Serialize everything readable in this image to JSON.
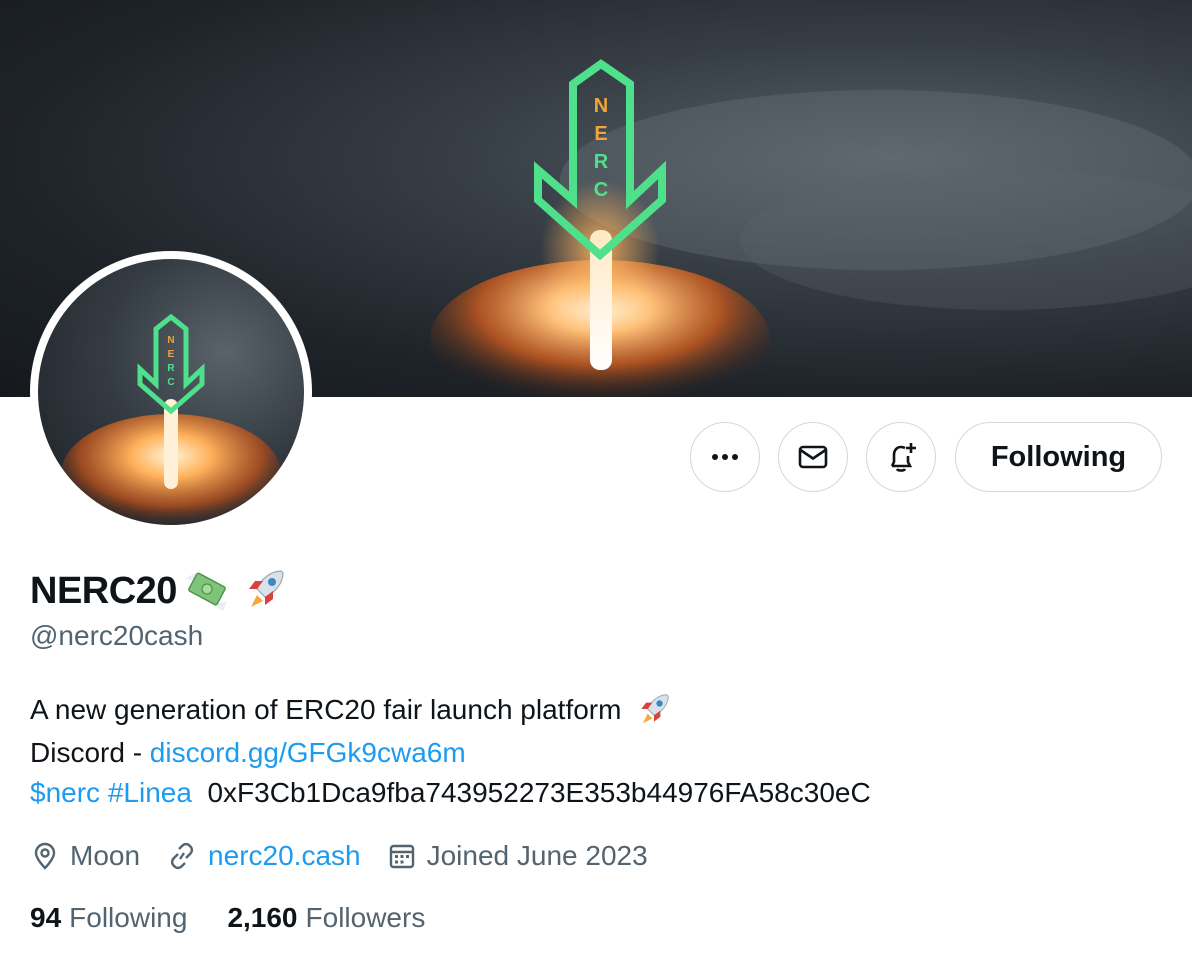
{
  "profile": {
    "name": "NERC20",
    "handle": "@nerc20cash",
    "logo_letters": [
      "N",
      "E",
      "R",
      "C"
    ]
  },
  "actions": {
    "following_label": "Following",
    "more_icon": "more-horizontal-icon",
    "message_icon": "envelope-icon",
    "notify_icon": "bell-plus-icon"
  },
  "bio": {
    "line1": "A new generation of ERC20 fair launch platform",
    "line2_prefix": "Discord - ",
    "line2_link": "discord.gg/GFGk9cwa6m",
    "cashtag": "$nerc",
    "hashtag": "#Linea",
    "address": "0xF3Cb1Dca9fba743952273E353b44976FA58c30eC"
  },
  "meta": {
    "location": "Moon",
    "website": "nerc20.cash",
    "joined": "Joined June 2023"
  },
  "stats": {
    "following_count": "94",
    "following_label": "Following",
    "followers_count": "2,160",
    "followers_label": "Followers"
  },
  "colors": {
    "accent": "#1d9bf0",
    "logo_green": "#4ee08a",
    "logo_orange": "#f0a43a",
    "muted": "#536471"
  }
}
